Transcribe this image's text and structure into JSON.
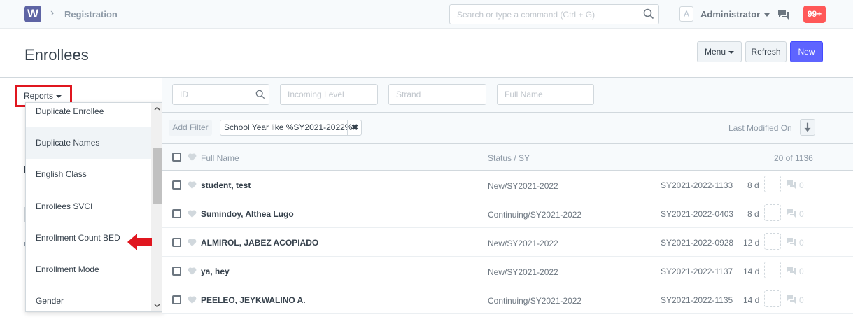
{
  "navbar": {
    "logo": "W",
    "breadcrumb": "Registration",
    "search_placeholder": "Search or type a command (Ctrl + G)",
    "avatar": "A",
    "user": "Administrator",
    "notifications": "99+"
  },
  "page": {
    "title": "Enrollees",
    "menu_label": "Menu",
    "refresh_label": "Refresh",
    "new_label": "New"
  },
  "sidebar": {
    "reports_label": "Reports",
    "reports_menu": [
      "Duplicate Enrollee",
      "Duplicate Names",
      "English Class",
      "Enrollees SVCI",
      "Enrollment Count BED",
      "Enrollment Mode",
      "Gender"
    ]
  },
  "filters": {
    "id_placeholder": "ID",
    "level_placeholder": "Incoming Level",
    "strand_placeholder": "Strand",
    "name_placeholder": "Full Name",
    "add_filter": "Add Filter",
    "active_filter": "School Year like %SY2021-2022%",
    "remove": "✖",
    "sort_label": "Last Modified On"
  },
  "list": {
    "col_name": "Full Name",
    "col_status": "Status / SY",
    "count": "20 of 1136",
    "rows": [
      {
        "name": "student, test",
        "status": "New/SY2021-2022",
        "id": "SY2021-2022-1133",
        "age": "8 d",
        "comments": "0"
      },
      {
        "name": "Sumindoy, Althea Lugo",
        "status": "Continuing/SY2021-2022",
        "id": "SY2021-2022-0403",
        "age": "8 d",
        "comments": "0"
      },
      {
        "name": "ALMIROL, JABEZ ACOPIADO",
        "status": "New/SY2021-2022",
        "id": "SY2021-2022-0928",
        "age": "12 d",
        "comments": "0"
      },
      {
        "name": "ya, hey",
        "status": "New/SY2021-2022",
        "id": "SY2021-2022-1137",
        "age": "14 d",
        "comments": "0"
      },
      {
        "name": "PEELEO, JEYKWALINO A.",
        "status": "Continuing/SY2021-2022",
        "id": "SY2021-2022-1135",
        "age": "14 d",
        "comments": "0"
      }
    ]
  },
  "colors": {
    "primary": "#5e64ff",
    "highlight_red": "#e0161f",
    "notification": "#ff5858"
  }
}
